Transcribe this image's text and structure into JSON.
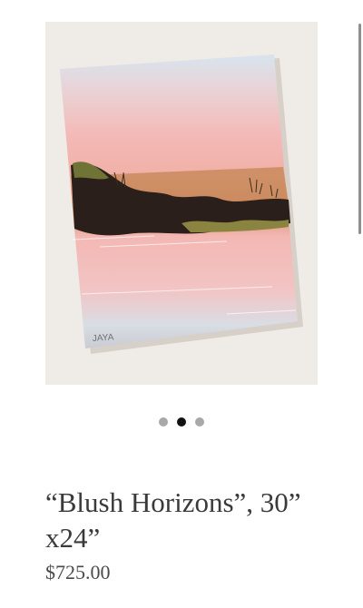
{
  "product": {
    "title": "“Blush Horizons”, 30” x24”",
    "price": "$725.00",
    "image": {
      "signature": "JAYA",
      "colors": {
        "backdrop": "#efebe6",
        "sky_blue": "#cfe0ea",
        "blush_pink": "#f2b7b4",
        "terracotta": "#c98a5c",
        "dark_land": "#2a1f1a",
        "moss": "#7a7a3a"
      }
    }
  },
  "carousel": {
    "slide_count": 3,
    "active_index": 1
  },
  "scroll": {
    "position_fraction": 0.0
  }
}
